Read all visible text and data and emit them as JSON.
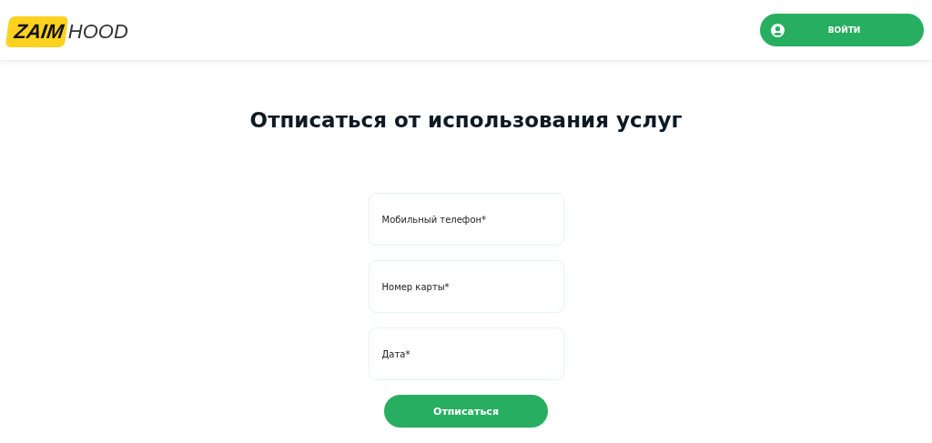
{
  "header": {
    "logo": {
      "badge": "ZAIM",
      "text": "HOOD"
    },
    "login_button": "ВОЙТИ"
  },
  "title": "Отписаться от использования услуг",
  "form": {
    "fields": [
      {
        "placeholder": "Мобильный телефон*"
      },
      {
        "placeholder": "Номер карты*"
      },
      {
        "placeholder": "Дата*"
      }
    ],
    "submit": "Отписаться"
  }
}
